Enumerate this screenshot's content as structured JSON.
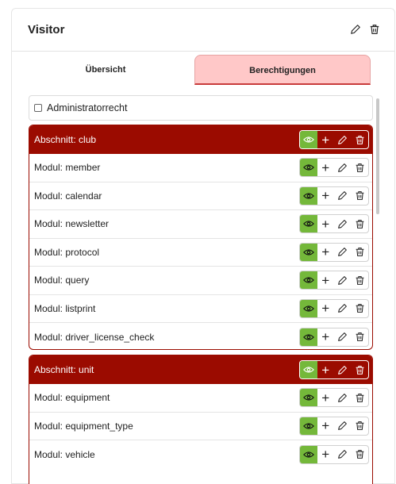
{
  "header": {
    "title": "Visitor"
  },
  "tabs": [
    {
      "label": "Übersicht",
      "active": false
    },
    {
      "label": "Berechtigungen",
      "active": true
    }
  ],
  "admin": {
    "label": "Administratorrecht",
    "checked": false
  },
  "sections": [
    {
      "title": "Abschnitt: club",
      "modules": [
        "Modul: member",
        "Modul: calendar",
        "Modul: newsletter",
        "Modul: protocol",
        "Modul: query",
        "Modul: listprint",
        "Modul: driver_license_check"
      ]
    },
    {
      "title": "Abschnitt: unit",
      "modules": [
        "Modul: equipment",
        "Modul: equipment_type",
        "Modul: vehicle"
      ]
    }
  ],
  "actions": {
    "plus_glyph": "+"
  },
  "icons": [
    "edit-icon",
    "trash-icon",
    "eye-icon",
    "plus-icon",
    "pencil-icon"
  ],
  "colors": {
    "section_header": "#9b0b00",
    "active_tab": "#ffc8c8",
    "view_permission": "#74b83a"
  }
}
